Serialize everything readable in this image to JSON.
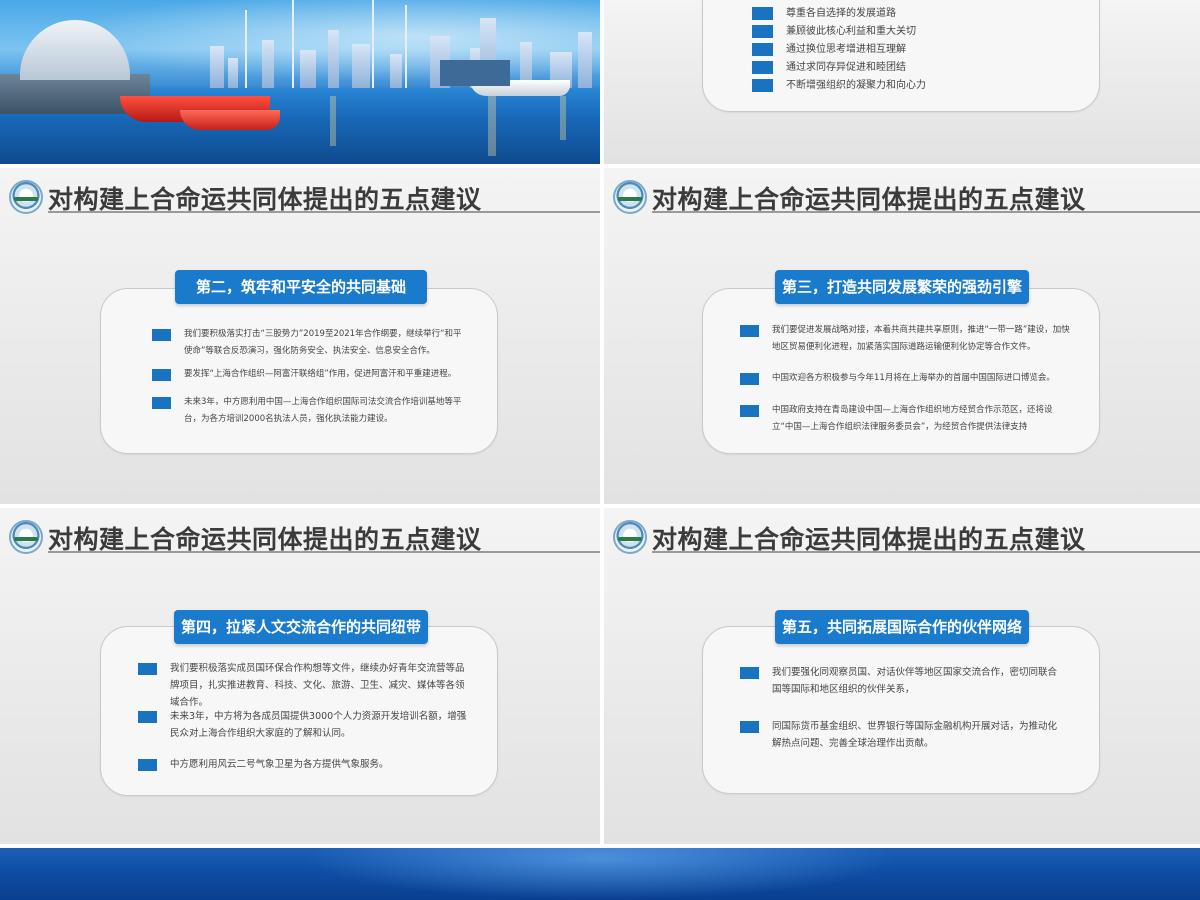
{
  "top_right": {
    "items": [
      "尊重各自选择的发展道路",
      "兼顾彼此核心利益和重大关切",
      "通过换位思考增进相互理解",
      "通过求同存异促进和睦团结",
      "不断增强组织的凝聚力和向心力"
    ]
  },
  "slides": [
    {
      "title": "对构建上合命运共同体提出的五点建议",
      "heading": "第二，筑牢和平安全的共同基础",
      "items": [
        "我们要积极落实打击“三股势力”2019至2021年合作纲要，继续举行“和平使命”等联合反恐演习，强化防务安全、执法安全、信息安全合作。",
        "要发挥“上海合作组织—阿富汗联络组”作用，促进阿富汗和平重建进程。",
        "未来3年，中方愿利用中国—上海合作组织国际司法交流合作培训基地等平台，为各方培训2000名执法人员，强化执法能力建设。"
      ]
    },
    {
      "title": "对构建上合命运共同体提出的五点建议",
      "heading": "第三，打造共同发展繁荣的强劲引擎",
      "items": [
        "我们要促进发展战略对接，本着共商共建共享原则，推进“一带一路”建设，加快地区贸易便利化进程，加紧落实国际道路运输便利化协定等合作文件。",
        "中国欢迎各方积极参与今年11月将在上海举办的首届中国国际进口博览会。",
        "中国政府支持在青岛建设中国—上海合作组织地方经贸合作示范区，还将设立“中国—上海合作组织法律服务委员会”，为经贸合作提供法律支持"
      ]
    },
    {
      "title": "对构建上合命运共同体提出的五点建议",
      "heading": "第四，拉紧人文交流合作的共同纽带",
      "items": [
        "我们要积极落实成员国环保合作构想等文件，继续办好青年交流营等品牌项目，扎实推进教育、科技、文化、旅游、卫生、减灾、媒体等各领域合作。",
        "未来3年，中方将为各成员国提供3000个人力资源开发培训名额，增强民众对上海合作组织大家庭的了解和认同。",
        "中方愿利用风云二号气象卫星为各方提供气象服务。"
      ]
    },
    {
      "title": "对构建上合命运共同体提出的五点建议",
      "heading": "第五，共同拓展国际合作的伙伴网络",
      "items": [
        "我们要强化同观察员国、对话伙伴等地区国家交流合作，密切同联合国等国际和地区组织的伙伴关系，",
        "同国际货币基金组织、世界银行等国际金融机构开展对话，为推动化解热点问题、完善全球治理作出贡献。"
      ]
    }
  ]
}
